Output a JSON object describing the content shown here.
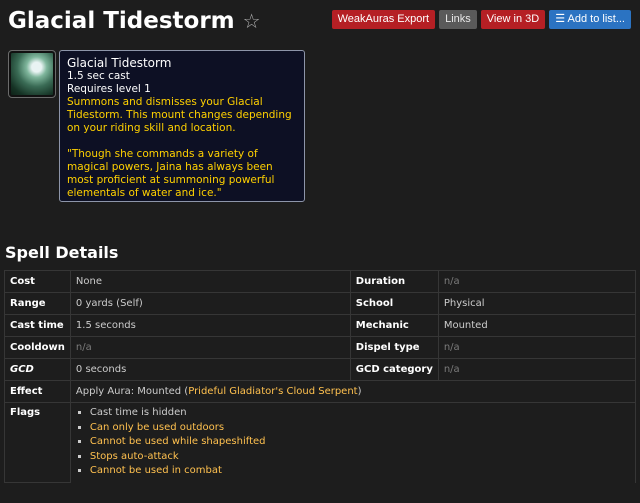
{
  "title": "Glacial Tidestorm",
  "toolbar": {
    "weakauras": "WeakAuras Export",
    "links": "Links",
    "view3d": "View in 3D",
    "add_list": "Add to list..."
  },
  "tooltip": {
    "name": "Glacial Tidestorm",
    "cast": "1.5 sec cast",
    "requires": "Requires level 1",
    "desc": "Summons and dismisses your Glacial Tidestorm. This mount changes depending on your riding skill and location.",
    "quote": "\"Though she commands a variety of magical powers, Jaina has always been most proficient at summoning powerful elementals of water and ice.\""
  },
  "section_title": "Spell Details",
  "details": {
    "cost_label": "Cost",
    "cost": "None",
    "duration_label": "Duration",
    "duration": "n/a",
    "range_label": "Range",
    "range": "0 yards (Self)",
    "school_label": "School",
    "school": "Physical",
    "casttime_label": "Cast time",
    "casttime": "1.5 seconds",
    "mechanic_label": "Mechanic",
    "mechanic": "Mounted",
    "cooldown_label": "Cooldown",
    "cooldown": "n/a",
    "dispel_label": "Dispel type",
    "dispel": "n/a",
    "gcd_label": "GCD",
    "gcd": "0 seconds",
    "gcdcat_label": "GCD category",
    "gcdcat": "n/a",
    "effect_label": "Effect",
    "effect_prefix": "Apply Aura: Mounted (",
    "effect_link": "Prideful Gladiator's Cloud Serpent",
    "effect_suffix": ")",
    "flags_label": "Flags",
    "flags": [
      "Cast time is hidden",
      "Can only be used outdoors",
      "Cannot be used while shapeshifted",
      "Stops auto-attack",
      "Cannot be used in combat"
    ]
  }
}
